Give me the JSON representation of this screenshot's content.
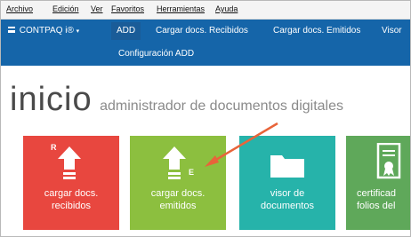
{
  "menu": [
    "Archivo",
    "Edición",
    "Ver",
    "Favoritos",
    "Herramientas",
    "Ayuda"
  ],
  "app": {
    "brand": "CONTPAQ i®",
    "tabs": [
      "ADD",
      "Cargar docs. Recibidos",
      "Cargar docs. Emitidos",
      "Visor"
    ],
    "subtab": "Configuración ADD"
  },
  "title": {
    "big": "inicio",
    "small": "administrador de documentos digitales"
  },
  "tiles": [
    {
      "line1": "cargar docs.",
      "line2": "recibidos",
      "badge": "R"
    },
    {
      "line1": "cargar docs.",
      "line2": "emitidos",
      "badge": "E"
    },
    {
      "line1": "visor de",
      "line2": "documentos"
    },
    {
      "line1": "certificad",
      "line2": "folios del"
    }
  ],
  "colors": {
    "appbar": "#1565a9",
    "tile_red": "#e8473f",
    "tile_lime": "#8cbf3f",
    "tile_teal": "#26b3aa",
    "tile_green": "#5fa85a",
    "arrow": "#e8643a"
  }
}
